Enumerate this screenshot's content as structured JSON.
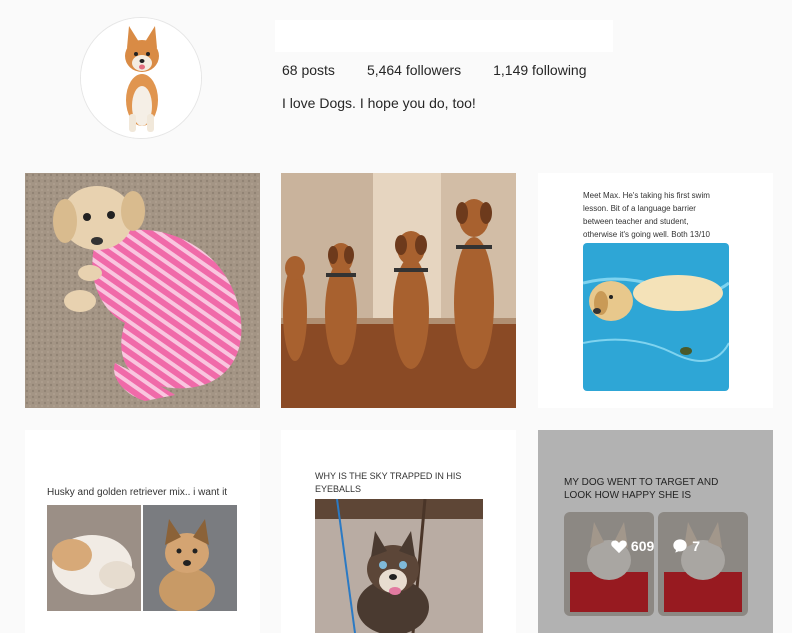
{
  "profile": {
    "username": "",
    "stats": {
      "posts": "68 posts",
      "followers": "5,464 followers",
      "following": "1,149 following"
    },
    "bio": "I love Dogs. I hope you do, too!"
  },
  "posts": [
    {
      "alt": "puppy in pink striped onesie"
    },
    {
      "alt": "dogs sitting in a row"
    },
    {
      "caption_lines": [
        "Meet Max. He's taking his first swim",
        "lesson. Bit of a language barrier",
        "between teacher and student,",
        "otherwise it's going well. Both 13/10"
      ]
    },
    {
      "caption_lines": [
        "Husky and golden retriever mix.. i want it"
      ]
    },
    {
      "caption_lines": [
        "WHY IS THE SKY TRAPPED IN HIS",
        "EYEBALLS"
      ]
    },
    {
      "caption_lines": [
        "MY DOG WENT TO TARGET AND",
        "LOOK HOW HAPPY SHE IS"
      ],
      "likes": "609",
      "comments": "7"
    }
  ],
  "icons": [
    "heart-icon",
    "comment-icon"
  ]
}
